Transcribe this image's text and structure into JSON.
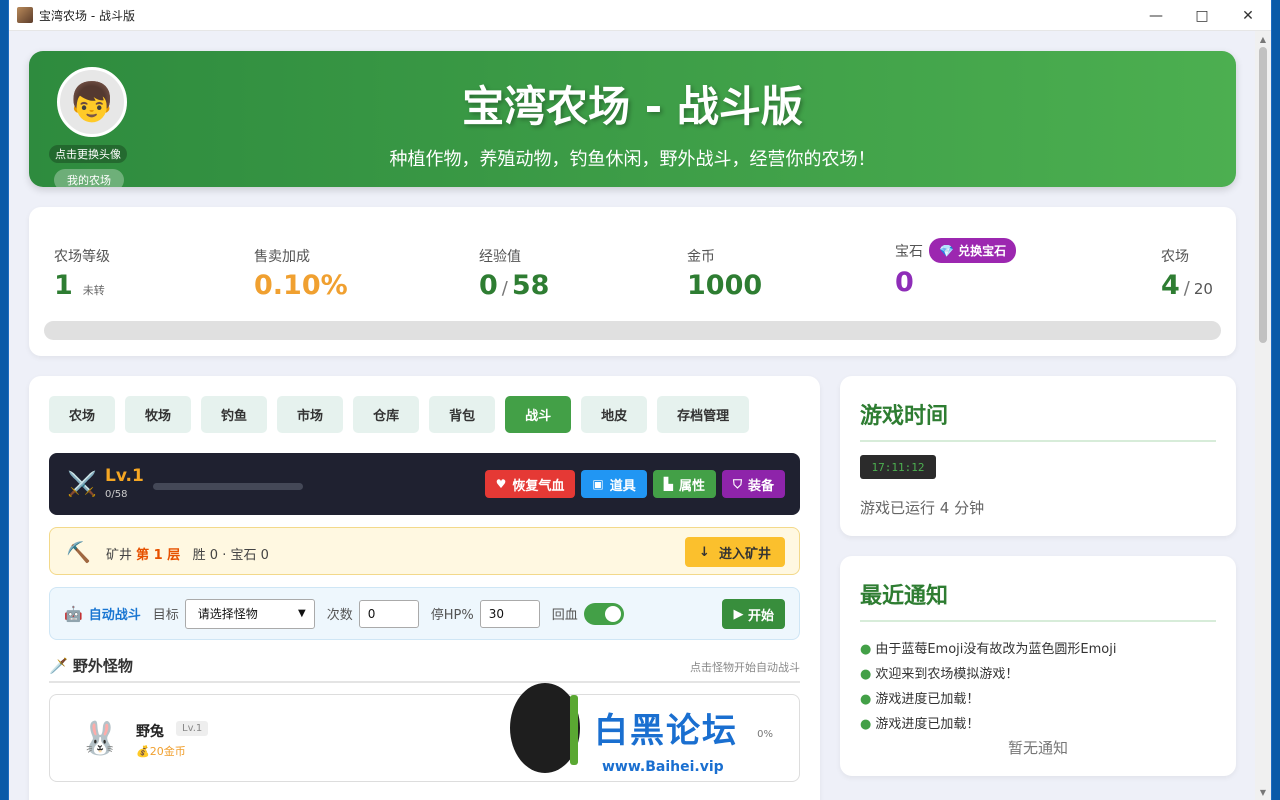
{
  "window": {
    "title": "宝湾农场 - 战斗版"
  },
  "banner": {
    "title": "宝湾农场 - 战斗版",
    "subtitle": "种植作物，养殖动物，钓鱼休闲，野外战斗，经营你的农场！",
    "avatar_label": "点击更换头像",
    "farm_button": "我的农场"
  },
  "stats": {
    "level_label": "农场等级",
    "level_value": "1",
    "level_sub": "未转",
    "sell_label": "售卖加成",
    "sell_value": "0.10%",
    "exp_label": "经验值",
    "exp_value": "0",
    "exp_max": "58",
    "gold_label": "金币",
    "gold_value": "1000",
    "gem_label": "宝石",
    "gem_button": "兑换宝石",
    "gem_value": "0",
    "farm_label": "农场",
    "farm_value": "4",
    "farm_max": "20",
    "exp_progress": 0
  },
  "tabs": [
    "农场",
    "牧场",
    "钓鱼",
    "市场",
    "仓库",
    "背包",
    "战斗",
    "地皮",
    "存档管理"
  ],
  "active_tab": "战斗",
  "battle": {
    "level": "Lv.1",
    "exp": "0/58",
    "exp_progress": 0,
    "buttons": {
      "heal": "恢复气血",
      "items": "道具",
      "attributes": "属性",
      "equipment": "装备"
    }
  },
  "mine": {
    "prefix": "矿井",
    "floor": "第 1 层",
    "stats": "胜 0 · 宝石 0",
    "enter": "进入矿井"
  },
  "auto_battle": {
    "title": "自动战斗",
    "target_label": "目标",
    "target_value": "请选择怪物",
    "count_label": "次数",
    "count_value": "0",
    "stop_hp_label": "停HP%",
    "stop_hp_value": "30",
    "heal_label": "回血",
    "heal_enabled": true,
    "start": "开始"
  },
  "monsters": {
    "title": "野外怪物",
    "hint": "点击怪物开始自动战斗",
    "items": [
      {
        "name": "野兔",
        "level": "Lv.1",
        "reward": "20金币",
        "progress": "0%"
      }
    ]
  },
  "game_time": {
    "title": "游戏时间",
    "clock": "17:11:12",
    "running": "游戏已运行 4 分钟"
  },
  "notices": {
    "title": "最近通知",
    "items": [
      "由于蓝莓Emoji没有故改为蓝色圆形Emoji",
      "欢迎来到农场模拟游戏！",
      "游戏进度已加载！",
      "游戏进度已加载！"
    ],
    "empty": "暂无通知"
  },
  "watermark": {
    "text": "白黑论坛",
    "url": "www.Baihei.vip"
  },
  "colors": {
    "primary": "#43a047",
    "banner": "#4caf50",
    "heal": "#e53935",
    "items": "#2196f3",
    "equip": "#8e24aa",
    "mine": "#fbc02d"
  }
}
